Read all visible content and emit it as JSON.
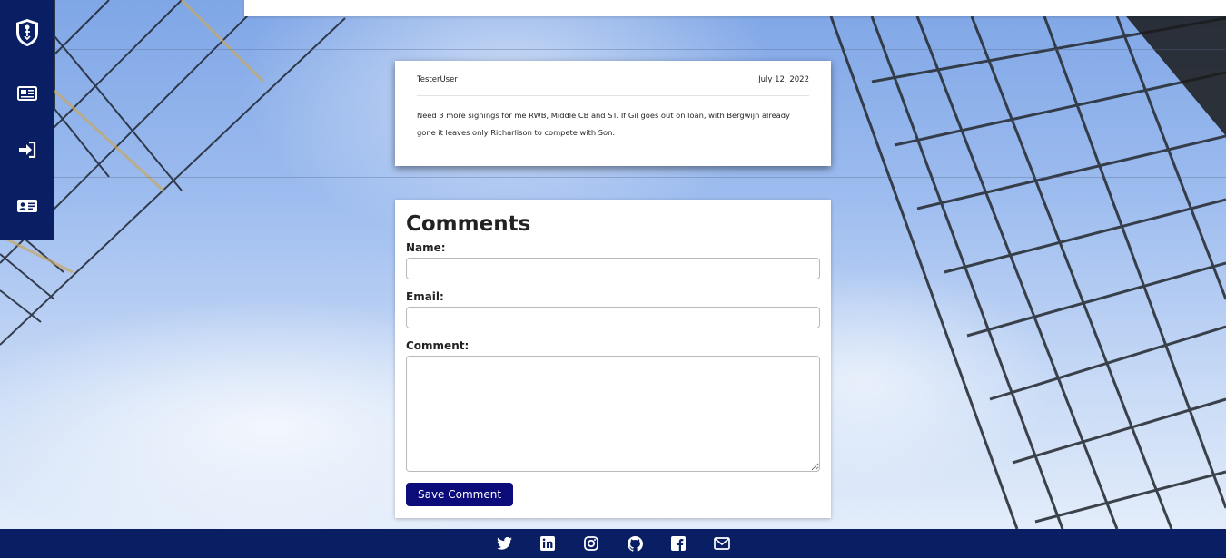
{
  "side_nav": {
    "items": [
      {
        "icon": "club-crest-icon",
        "name": "home"
      },
      {
        "icon": "newspaper-icon",
        "name": "news"
      },
      {
        "icon": "sign-in-icon",
        "name": "login"
      },
      {
        "icon": "id-card-icon",
        "name": "register"
      }
    ]
  },
  "post": {
    "author": "TesterUser",
    "date": "July 12, 2022",
    "body": "Need 3 more signings for me RWB, Middle CB and ST. If Gil goes out on loan, with Bergwijn already gone it leaves only Richarlison to compete with Son."
  },
  "comments": {
    "title": "Comments",
    "name_label": "Name:",
    "name_value": "",
    "email_label": "Email:",
    "email_value": "",
    "comment_label": "Comment:",
    "comment_value": "",
    "save_label": "Save Comment"
  },
  "footer": {
    "icons": [
      "twitter-icon",
      "linkedin-icon",
      "instagram-icon",
      "github-icon",
      "facebook-icon",
      "email-icon"
    ]
  },
  "colors": {
    "nav_bg": "#0a1f63",
    "button_bg": "#0b0b7a"
  }
}
